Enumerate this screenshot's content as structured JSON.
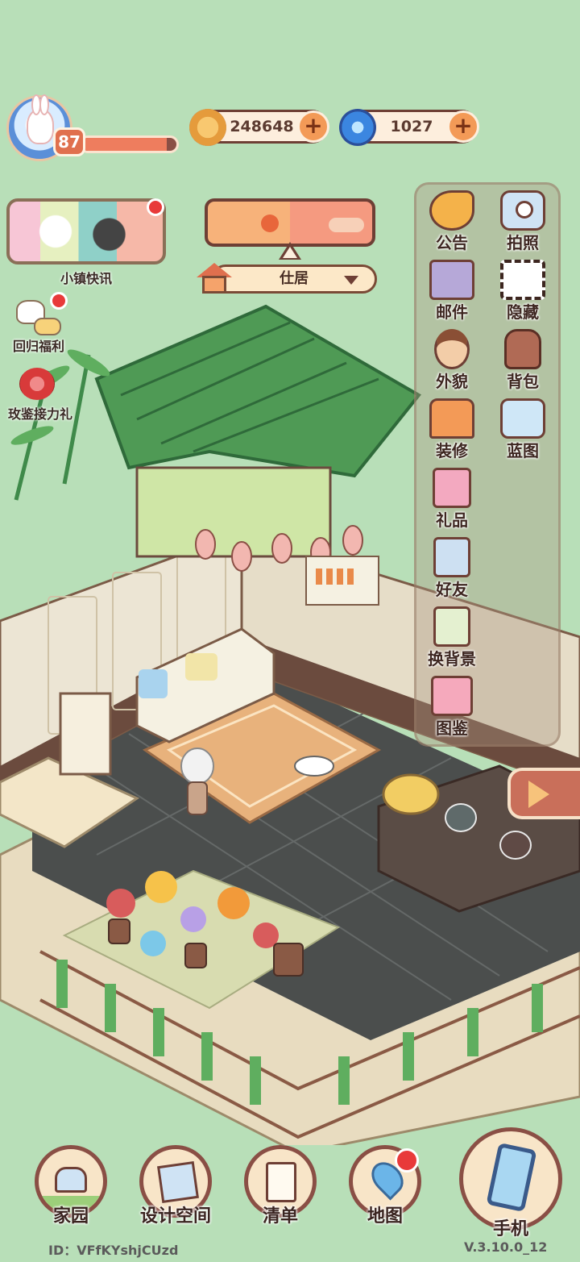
{
  "player": {
    "level": "87",
    "xp_fraction": 0.9
  },
  "currencies": {
    "coins": "248648",
    "gems": "1027"
  },
  "left_menu": {
    "news_label": "小镇快讯",
    "return_label": "回归福利",
    "rose_label": "玫鉴接力礼"
  },
  "location": {
    "name": "仕居"
  },
  "right_menu": {
    "items": [
      {
        "label": "公告"
      },
      {
        "label": "拍照"
      },
      {
        "label": "邮件"
      },
      {
        "label": "隐藏"
      },
      {
        "label": "外貌"
      },
      {
        "label": "背包"
      },
      {
        "label": "装修"
      },
      {
        "label": "蓝图"
      },
      {
        "label": "礼品"
      },
      {
        "label": "好友"
      },
      {
        "label": "换背景"
      },
      {
        "label": "图鉴"
      }
    ]
  },
  "bottom_nav": {
    "home": "家园",
    "design": "设计空间",
    "list": "清单",
    "map": "地图",
    "phone": "手机"
  },
  "footer": {
    "id": "ID：VFfKYshjCUzd",
    "version": "V.3.10.0_12"
  },
  "colors": {
    "background": "#b8dfb8",
    "accent": "#ee7d5e",
    "frame": "#6e3f35"
  }
}
